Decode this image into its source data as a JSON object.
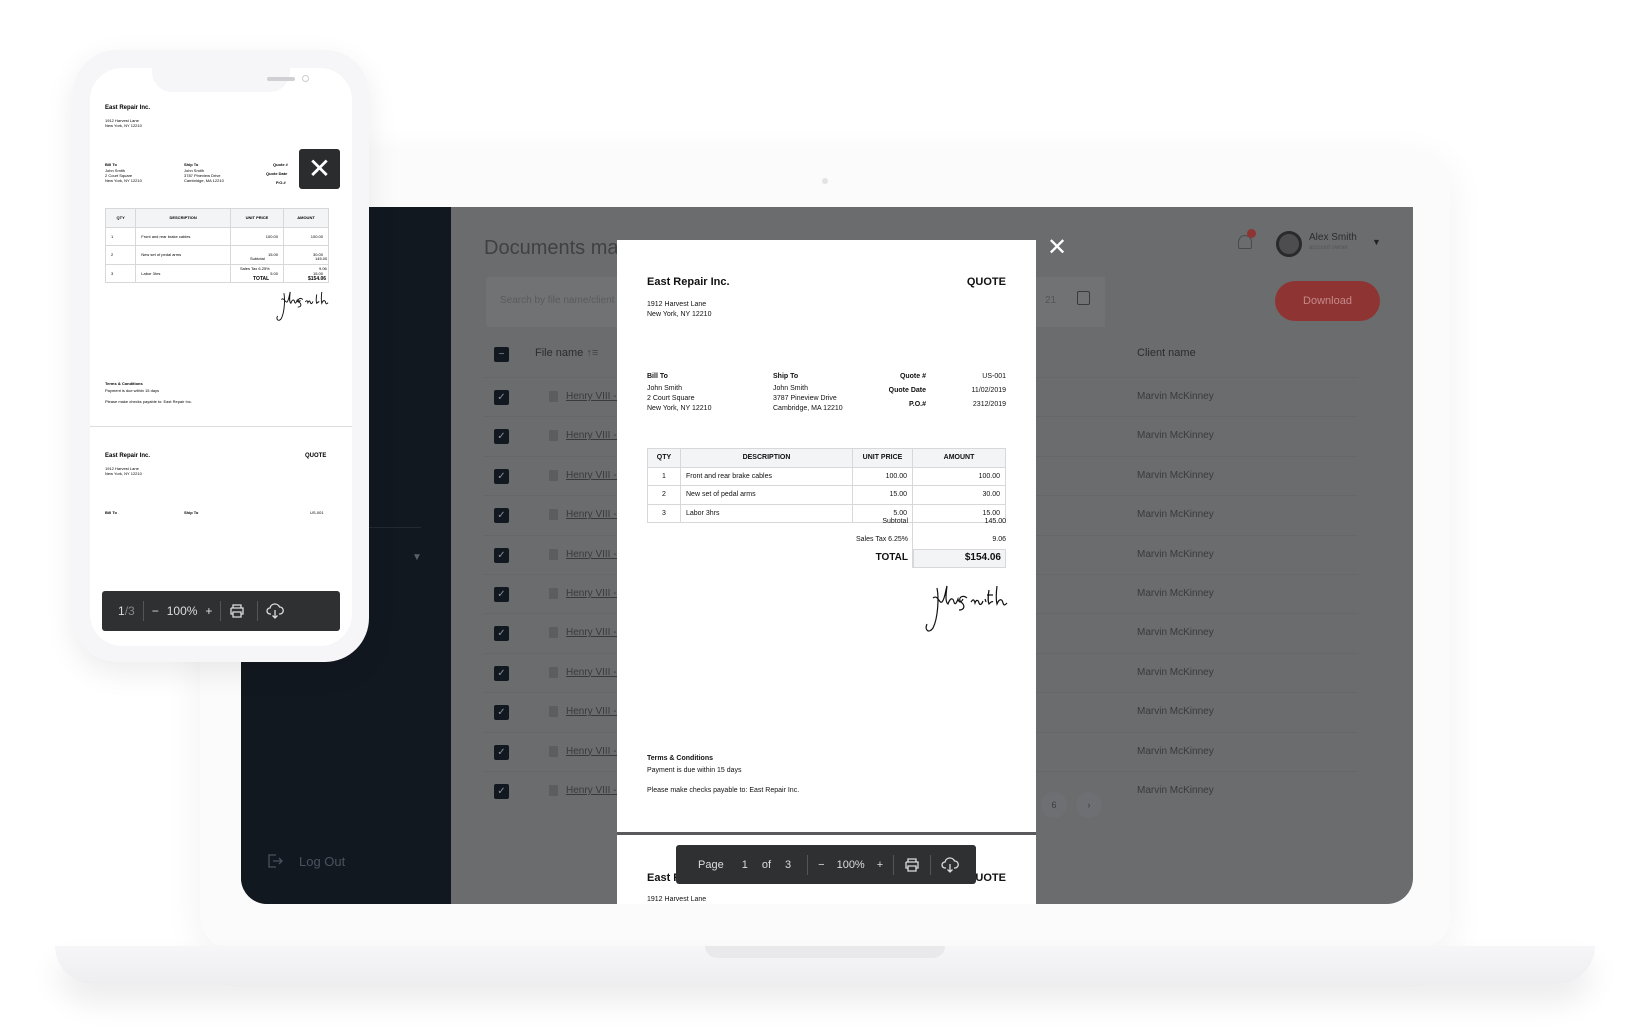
{
  "app": {
    "title": "Documents management",
    "title_visible": "Documents mar",
    "search_placeholder": "Search by file name/client name",
    "date_fragment": "21",
    "download_label": "Download",
    "notification_count": "1",
    "user": {
      "name": "Alex Smith",
      "role": "account owner"
    },
    "table": {
      "headers": {
        "file_name": "File name",
        "client_name": "Client name"
      },
      "rows": [
        {
          "file": "Henry VIII - I",
          "client": "Marvin McKinney",
          "checked": true
        },
        {
          "file": "Henry VIII - I",
          "client": "Marvin McKinney",
          "checked": true
        },
        {
          "file": "Henry VIII - I",
          "client": "Marvin McKinney",
          "checked": true
        },
        {
          "file": "Henry VIII - I",
          "client": "Marvin McKinney",
          "checked": true
        },
        {
          "file": "Henry VIII - I",
          "client": "Marvin McKinney",
          "checked": true
        },
        {
          "file": "Henry VIII - I",
          "client": "Marvin McKinney",
          "checked": true
        },
        {
          "file": "Henry VIII - I",
          "client": "Marvin McKinney",
          "checked": true
        },
        {
          "file": "Henry VIII - I",
          "client": "Marvin McKinney",
          "checked": true
        },
        {
          "file": "Henry VIII - I",
          "client": "Marvin McKinney",
          "checked": true
        },
        {
          "file": "Henry VIII - I",
          "client": "Marvin McKinney",
          "checked": true
        },
        {
          "file": "Henry VIII - I",
          "client": "Marvin McKinney",
          "checked": true
        }
      ]
    },
    "pagination": {
      "page": "6",
      "next": "›"
    },
    "sidebar": {
      "logout": "Log Out"
    },
    "colors": {
      "accent": "#8e3534",
      "sidebar": "#121820",
      "overlay": "#6b6c6e"
    }
  },
  "document": {
    "company": "East Repair Inc.",
    "doc_type": "QUOTE",
    "address": [
      "1912 Harvest Lane",
      "New York, NY 12210"
    ],
    "bill_to": {
      "label": "Bill To",
      "lines": [
        "John Smith",
        "2 Court Square",
        "New York, NY 12210"
      ]
    },
    "ship_to": {
      "label": "Ship To",
      "lines": [
        "John Smith",
        "3787 Pineview Drive",
        "Cambridge, MA 12210"
      ]
    },
    "meta": [
      {
        "label": "Quote #",
        "value": "US-001"
      },
      {
        "label": "Quote Date",
        "value": "11/02/2019"
      },
      {
        "label": "P.O.#",
        "value": "2312/2019"
      }
    ],
    "columns": [
      "QTY",
      "DESCRIPTION",
      "UNIT PRICE",
      "AMOUNT"
    ],
    "items": [
      {
        "qty": "1",
        "desc": "Front and rear brake cables",
        "price": "100.00",
        "amount": "100.00"
      },
      {
        "qty": "2",
        "desc": "New set of pedal arms",
        "price": "15.00",
        "amount": "30.00"
      },
      {
        "qty": "3",
        "desc": "Labor 3hrs",
        "price": "5.00",
        "amount": "15.00"
      }
    ],
    "subtotal": {
      "label": "Subtotal",
      "value": "145.00"
    },
    "tax": {
      "label": "Sales Tax 6.25%",
      "value": "9.06"
    },
    "total": {
      "label": "TOTAL",
      "value": "$154.06"
    },
    "signature": "John Smith",
    "terms": {
      "title": "Terms & Conditions",
      "line1": "Payment is due within 15 days",
      "line2": "Please make checks payable to: East Repair Inc."
    }
  },
  "viewer_toolbar": {
    "page_label": "Page",
    "page": "1",
    "of_label": "of",
    "total_pages": "3",
    "minus": "−",
    "zoom": "100%",
    "plus": "+"
  },
  "mobile_toolbar": {
    "page": "1",
    "total": "/3",
    "minus": "−",
    "zoom": "100%",
    "plus": "+"
  }
}
